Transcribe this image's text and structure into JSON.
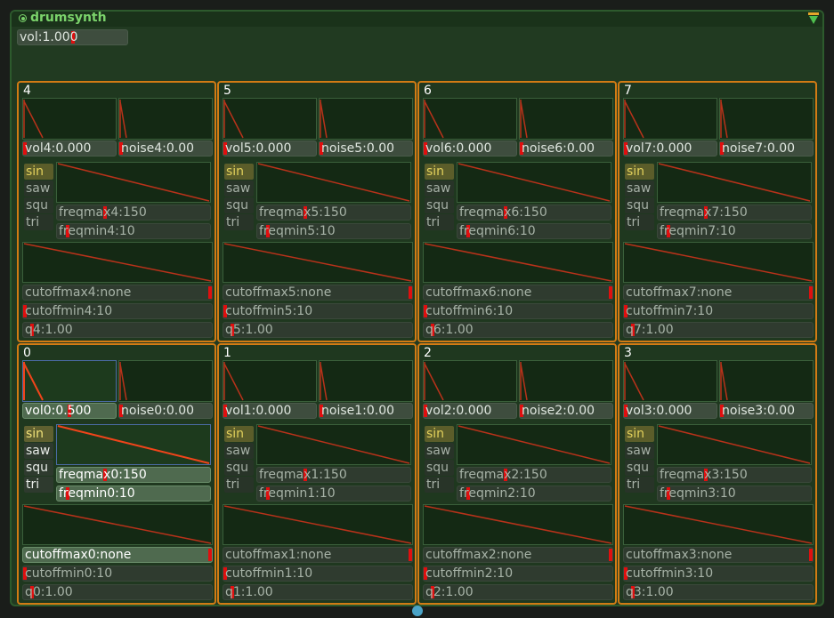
{
  "module": {
    "title": "drumsynth",
    "volume": {
      "label": "vol:1.000",
      "value": 1.0
    }
  },
  "colors": {
    "accent_green": "#7bd36b",
    "cell_border": "#d27b14",
    "marker_red": "#e00f0f",
    "port_blue": "#4aa3c7"
  },
  "icons": {
    "title": "status-dot-icon",
    "collapse": "collapse-triangle-icon",
    "port": "output-port-icon"
  },
  "waveforms": [
    "sin",
    "saw",
    "squ",
    "tri"
  ],
  "voices": [
    {
      "label": "4",
      "vol": "vol4:0.000",
      "noise": "noise4:0.00",
      "freqmax": "freqmax4:150",
      "freqmin": "freqmin4:10",
      "cutoffmax": "cutoffmax4:none",
      "cutoffmin": "cutoffmin4:10",
      "q": "q4:1.00",
      "waveform": "sin",
      "active": false
    },
    {
      "label": "5",
      "vol": "vol5:0.000",
      "noise": "noise5:0.00",
      "freqmax": "freqmax5:150",
      "freqmin": "freqmin5:10",
      "cutoffmax": "cutoffmax5:none",
      "cutoffmin": "cutoffmin5:10",
      "q": "q5:1.00",
      "waveform": "sin",
      "active": false
    },
    {
      "label": "6",
      "vol": "vol6:0.000",
      "noise": "noise6:0.00",
      "freqmax": "freqmax6:150",
      "freqmin": "freqmin6:10",
      "cutoffmax": "cutoffmax6:none",
      "cutoffmin": "cutoffmin6:10",
      "q": "q6:1.00",
      "waveform": "sin",
      "active": false
    },
    {
      "label": "7",
      "vol": "vol7:0.000",
      "noise": "noise7:0.00",
      "freqmax": "freqmax7:150",
      "freqmin": "freqmin7:10",
      "cutoffmax": "cutoffmax7:none",
      "cutoffmin": "cutoffmin7:10",
      "q": "q7:1.00",
      "waveform": "sin",
      "active": false
    },
    {
      "label": "0",
      "vol": "vol0:0.500",
      "noise": "noise0:0.00",
      "freqmax": "freqmax0:150",
      "freqmin": "freqmin0:10",
      "cutoffmax": "cutoffmax0:none",
      "cutoffmin": "cutoffmin0:10",
      "q": "q0:1.00",
      "waveform": "sin",
      "active": true
    },
    {
      "label": "1",
      "vol": "vol1:0.000",
      "noise": "noise1:0.00",
      "freqmax": "freqmax1:150",
      "freqmin": "freqmin1:10",
      "cutoffmax": "cutoffmax1:none",
      "cutoffmin": "cutoffmin1:10",
      "q": "q1:1.00",
      "waveform": "sin",
      "active": false
    },
    {
      "label": "2",
      "vol": "vol2:0.000",
      "noise": "noise2:0.00",
      "freqmax": "freqmax2:150",
      "freqmin": "freqmin2:10",
      "cutoffmax": "cutoffmax2:none",
      "cutoffmin": "cutoffmin2:10",
      "q": "q2:1.00",
      "waveform": "sin",
      "active": false
    },
    {
      "label": "3",
      "vol": "vol3:0.000",
      "noise": "noise3:0.00",
      "freqmax": "freqmax3:150",
      "freqmin": "freqmin3:10",
      "cutoffmax": "cutoffmax3:none",
      "cutoffmin": "cutoffmin3:10",
      "q": "q3:1.00",
      "waveform": "sin",
      "active": false
    }
  ]
}
